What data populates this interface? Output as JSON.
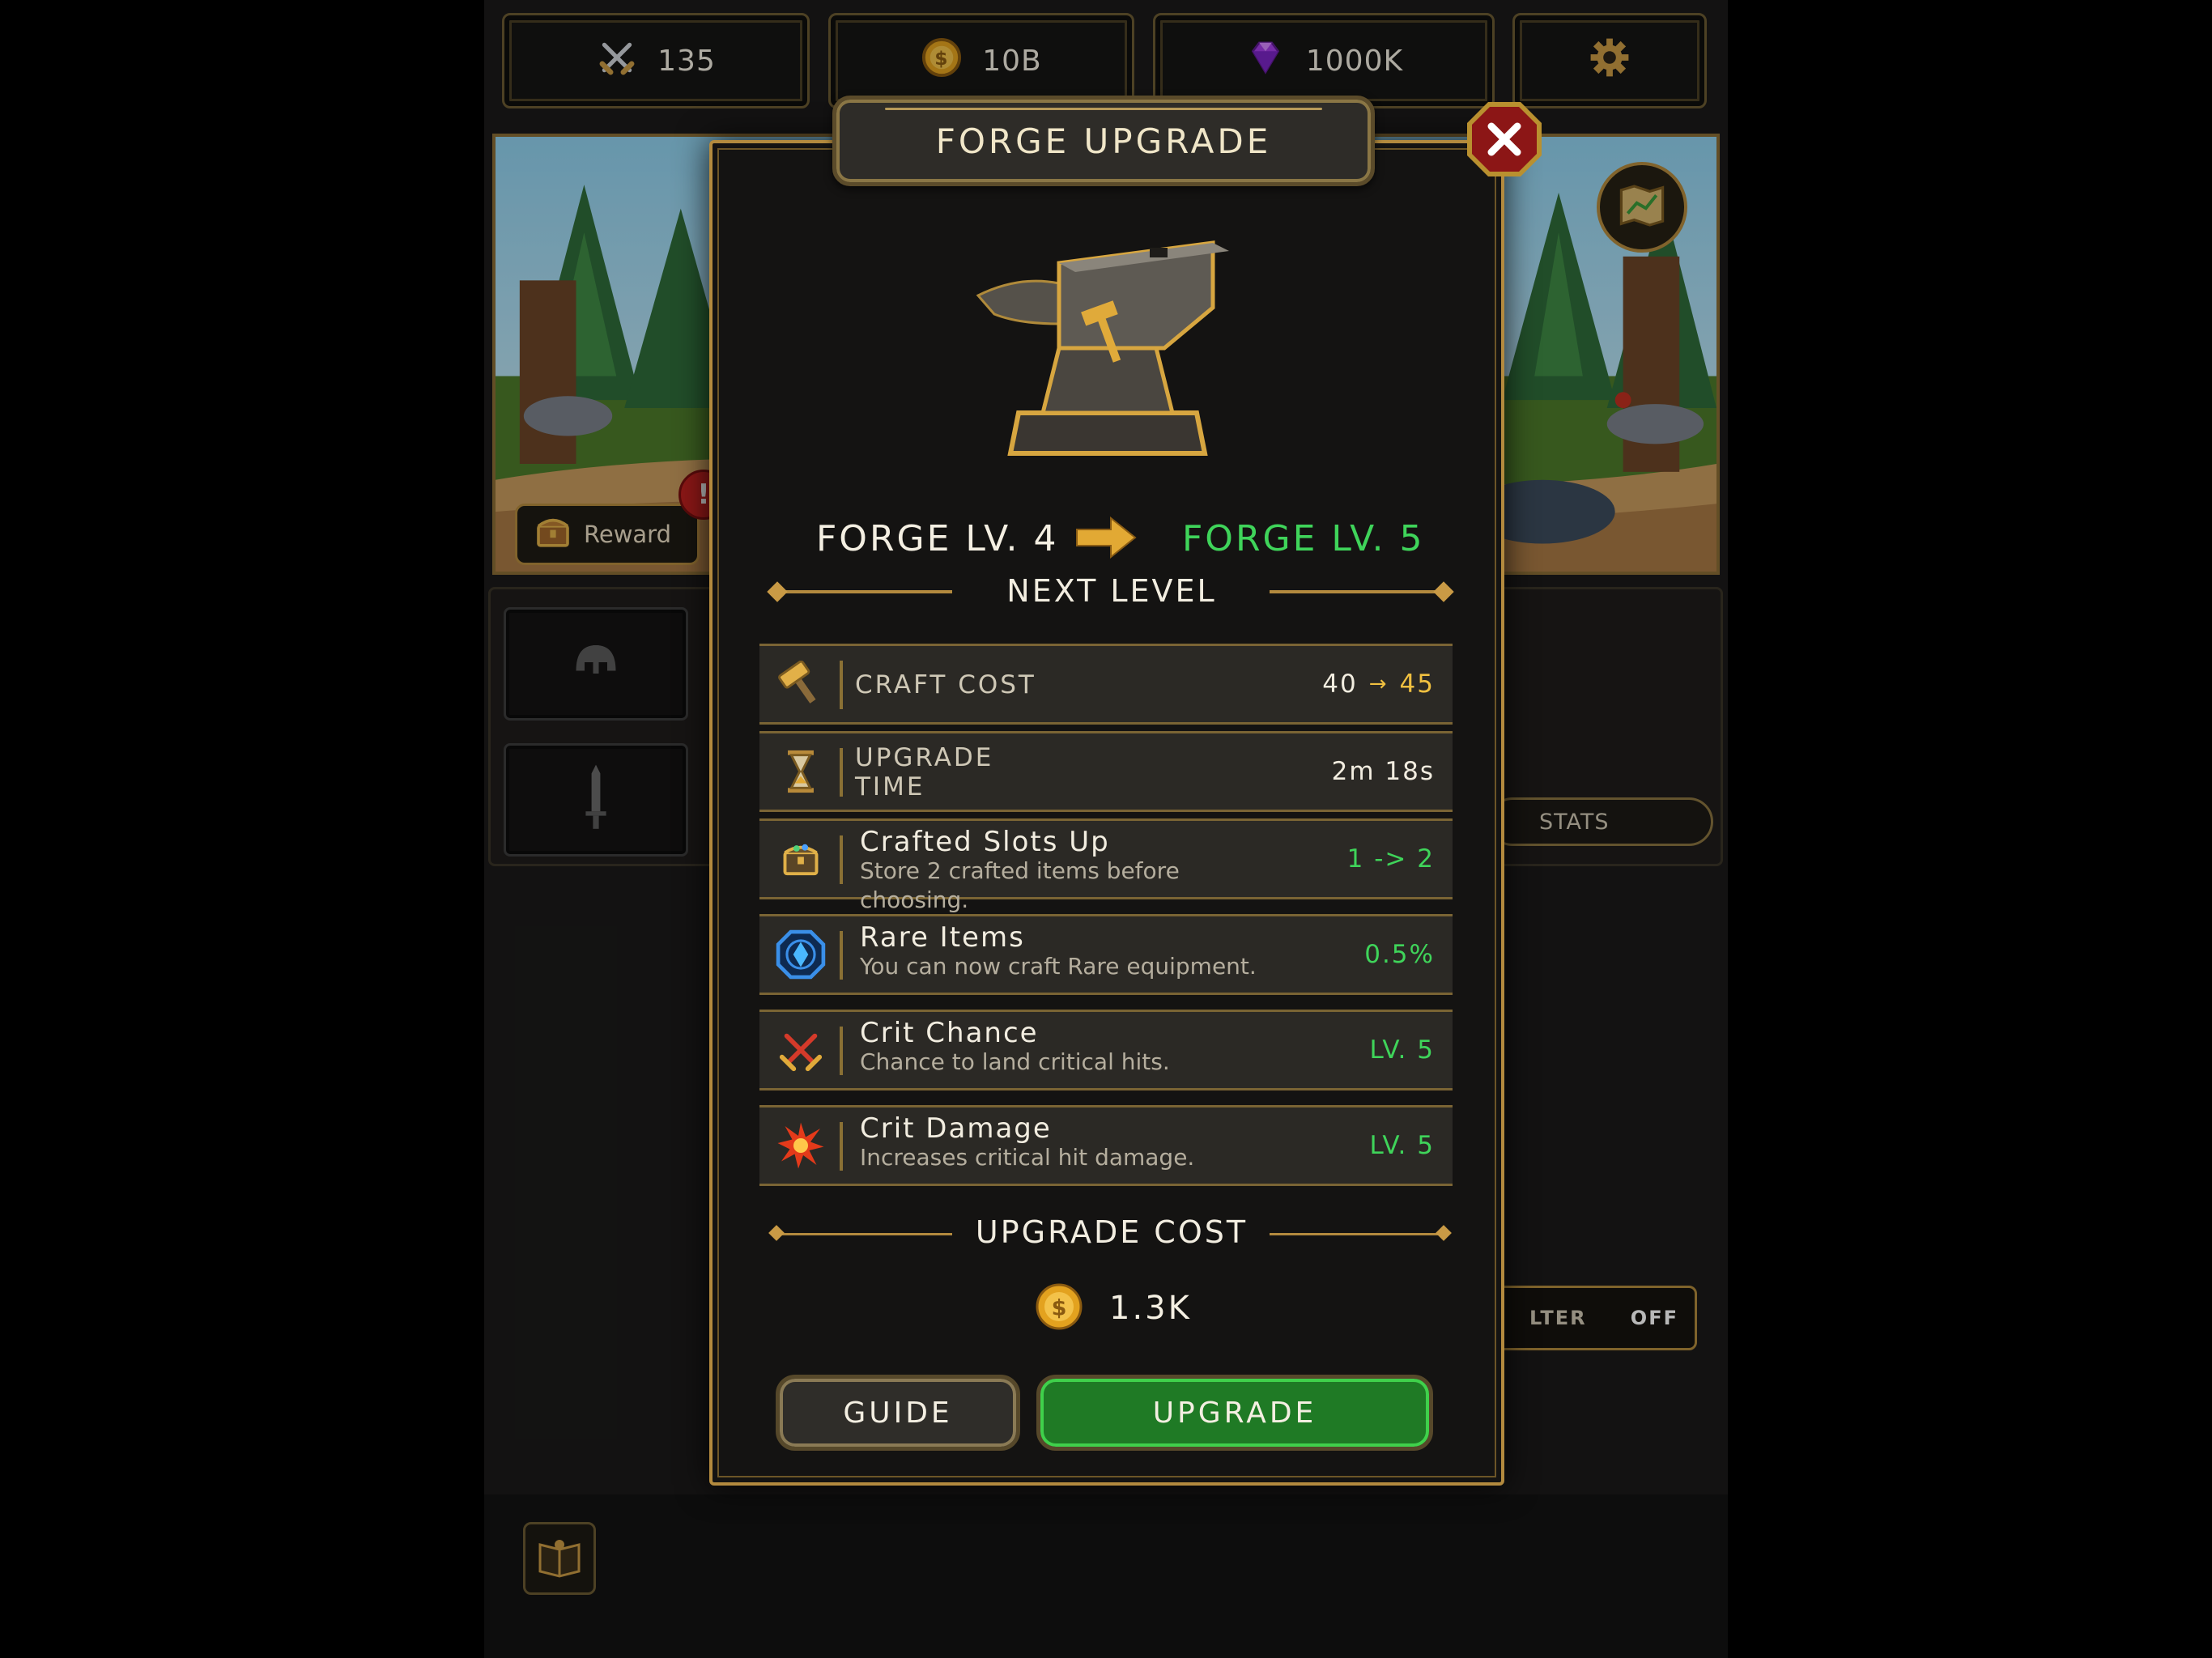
{
  "currencies": {
    "power": "135",
    "gold": "10B",
    "gems": "1000K"
  },
  "background": {
    "reward_label": "Reward",
    "alert_mark": "!",
    "stats_label": "STATS",
    "filter_label": "LTER",
    "filter_state": "OFF"
  },
  "modal": {
    "title": "FORGE UPGRADE",
    "current_level": "FORGE LV. 4",
    "next_level": "FORGE LV. 5",
    "next_level_heading": "NEXT LEVEL",
    "rows": [
      {
        "icon": "hammer-icon",
        "label": "CRAFT COST",
        "from": "40",
        "arrow": "→",
        "to": "45"
      },
      {
        "icon": "hourglass-icon",
        "label_line1": "UPGRADE",
        "label_line2": "TIME",
        "value": "2m 18s"
      },
      {
        "icon": "chest-icon",
        "name": "Crafted Slots Up",
        "desc": "Store 2 crafted items before choosing.",
        "value": "1 -> 2"
      },
      {
        "icon": "gem-icon",
        "name": "Rare Items",
        "desc": "You can now craft Rare equipment.",
        "value": "0.5%"
      },
      {
        "icon": "crossed-swords-icon",
        "name": "Crit Chance",
        "desc": "Chance to land critical hits.",
        "value": "LV. 5"
      },
      {
        "icon": "burst-icon",
        "name": "Crit Damage",
        "desc": "Increases critical hit damage.",
        "value": "LV. 5"
      }
    ],
    "upgrade_cost_heading": "UPGRADE COST",
    "upgrade_cost": "1.3K",
    "guide_label": "GUIDE",
    "upgrade_label": "UPGRADE"
  },
  "colors": {
    "accent_gold": "#b38a3e",
    "green": "#3fd45a",
    "upgrade_button": "#1f7a25"
  }
}
